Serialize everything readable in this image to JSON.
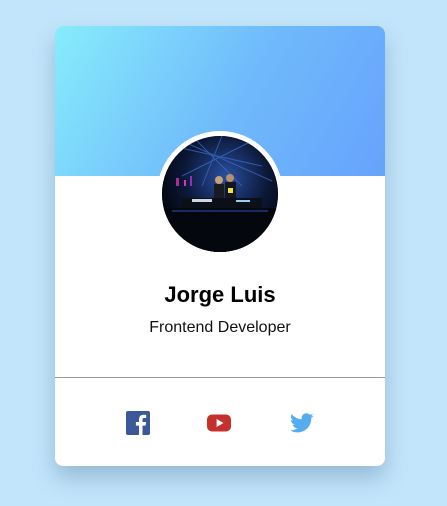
{
  "profile": {
    "name": "Jorge Luis",
    "role": "Frontend Developer",
    "avatar_icon": "dj-photo-avatar"
  },
  "banner": {
    "gradient_start": "#87ecfb",
    "gradient_end": "#66a3fc"
  },
  "social": [
    {
      "network": "Facebook",
      "icon": "facebook-icon",
      "color": "#3b5998"
    },
    {
      "network": "YouTube",
      "icon": "youtube-icon",
      "color": "#c4302b"
    },
    {
      "network": "Twitter",
      "icon": "twitter-icon",
      "color": "#55acee"
    }
  ]
}
